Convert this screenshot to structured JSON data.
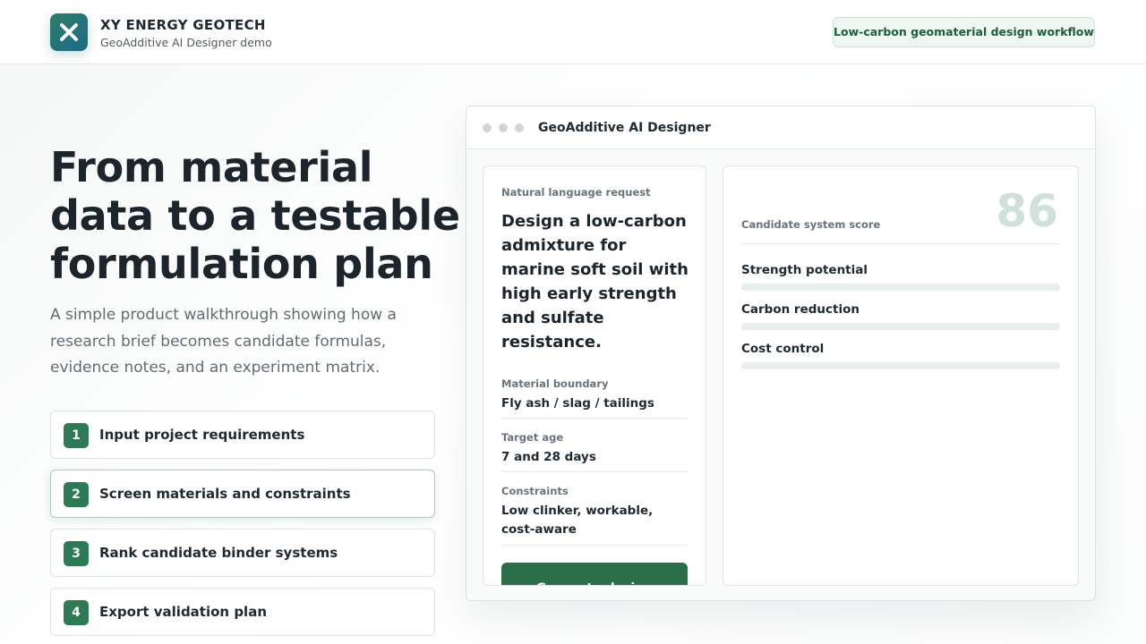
{
  "header": {
    "brand_name": "XY ENERGY GEOTECH",
    "brand_sub": "GeoAdditive AI Designer demo",
    "badge": "Low-carbon geomaterial design workflow",
    "logo_icon": "x-icon"
  },
  "hero": {
    "title": "From material data to a testable formulation plan",
    "description": "A simple product walkthrough showing how a research brief becomes candidate formulas, evidence notes, and an experiment matrix."
  },
  "steps": [
    {
      "num": "1",
      "label": "Input project requirements",
      "active": false
    },
    {
      "num": "2",
      "label": "Screen materials and constraints",
      "active": true
    },
    {
      "num": "3",
      "label": "Rank candidate binder systems",
      "active": false
    },
    {
      "num": "4",
      "label": "Export validation plan",
      "active": false
    }
  ],
  "window": {
    "title": "GeoAdditive AI Designer",
    "request": {
      "label": "Natural language request",
      "text": "Design a low-carbon admixture for marine soft soil with high early strength and sulfate resistance."
    },
    "fields": [
      {
        "label": "Material boundary",
        "value": "Fly ash / slag / tailings"
      },
      {
        "label": "Target age",
        "value": "7 and 28 days"
      },
      {
        "label": "Constraints",
        "value": "Low clinker, workable, cost-aware"
      }
    ],
    "generate_button": "Generate design",
    "score": {
      "label": "Candidate system score",
      "value": "86"
    },
    "metrics": [
      {
        "label": "Strength potential",
        "progress": 0
      },
      {
        "label": "Carbon reduction",
        "progress": 0
      },
      {
        "label": "Cost control",
        "progress": 0
      }
    ]
  },
  "colors": {
    "accent": "#2d7a55",
    "accent_dark": "#2a6e4a",
    "badge_bg": "#edf6f1",
    "score_muted": "#cfe1d8"
  }
}
